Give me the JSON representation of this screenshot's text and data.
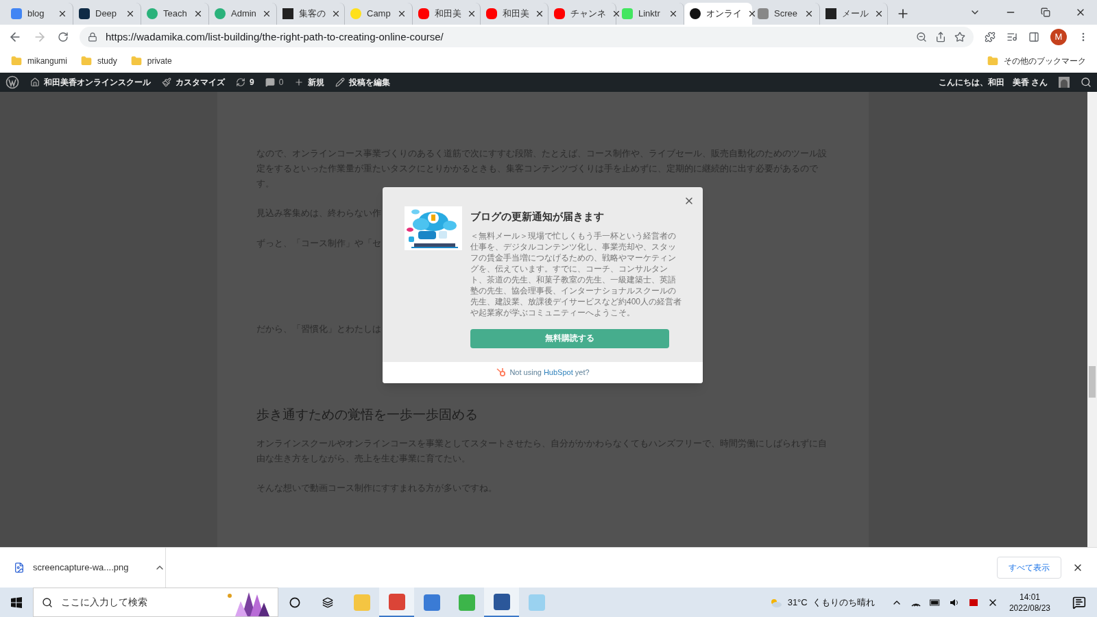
{
  "tabs": [
    {
      "title": "blog",
      "selected": false
    },
    {
      "title": "Deep",
      "selected": false
    },
    {
      "title": "Teach",
      "selected": false
    },
    {
      "title": "Admin",
      "selected": false
    },
    {
      "title": "集客の",
      "selected": false
    },
    {
      "title": "Camp",
      "selected": false
    },
    {
      "title": "和田美",
      "selected": false
    },
    {
      "title": "和田美",
      "selected": false
    },
    {
      "title": "チャンネ",
      "selected": false
    },
    {
      "title": "Linktr",
      "selected": false
    },
    {
      "title": "オンライ",
      "selected": true
    },
    {
      "title": "Scree",
      "selected": false
    },
    {
      "title": "メール",
      "selected": false
    }
  ],
  "address_bar": {
    "url": "https://wadamika.com/list-building/the-right-path-to-creating-online-course/",
    "profile_initial": "M"
  },
  "bookmarks": [
    "mikangumi",
    "study",
    "private"
  ],
  "other_bookmarks": "その他のブックマーク",
  "admin_bar": {
    "site": "和田美香オンラインスクール",
    "customize": "カスタマイズ",
    "updates": "9",
    "comments": "0",
    "new": "新規",
    "edit": "投稿を編集",
    "greeting": "こんにちは、和田　美香 さん"
  },
  "article": {
    "paragraphs_top": [
      "なので、オンラインコース事業づくりのあるく道筋で次にすすむ段階、たとえば、コース制作や、ライブセール、販売自動化のためのツール設定をするといった作業量が重たいタスクにとりかかるときも、集客コンテンツづくりは手を止めずに、定期的に継続的に出す必要があるのです。",
      "見込み客集めは、終わらない作",
      "ずっと、「コース制作」や「セ",
      "だから、「習慣化」とわたしは"
    ],
    "heading": "歩き通すための覚悟を一歩一歩固める",
    "paragraphs_bottom": [
      "オンラインスクールやオンラインコースを事業としてスタートさせたら、自分がかかわらなくてもハンズフリーで、時間労働にしばられずに自由な生き方をしながら、売上を生む事業に育てたい。",
      "そんな想いで動画コース制作にすすまれる方が多いですね。"
    ]
  },
  "modal": {
    "title": "ブログの更新通知が届きます",
    "body": "＜無料メール＞現場で忙しくもう手一杯という経営者の仕事を、デジタルコンテンツ化し、事業売却や、スタッフの賃金手当増につなげるための、戦略やマーケティングを、伝えています。すでに、コーチ、コンサルタント、茶道の先生、和菓子教室の先生、一級建築士、英語塾の先生、協会理事長、インターナショナルスクールの先生、建設業、放課後デイサービスなど約400人の経営者や起業家が学ぶコミュニティーへようこそ。",
    "button": "無料購読する",
    "footer": "Not using **HubSpot** yet?"
  },
  "download_bar": {
    "file": "screencapture-wa....png",
    "show_all": "すべて表示"
  },
  "taskbar": {
    "search_placeholder": "ここに入力して検索",
    "weather": "31°C  くもりのち晴れ",
    "time": "14:01",
    "date": "2022/08/23"
  }
}
